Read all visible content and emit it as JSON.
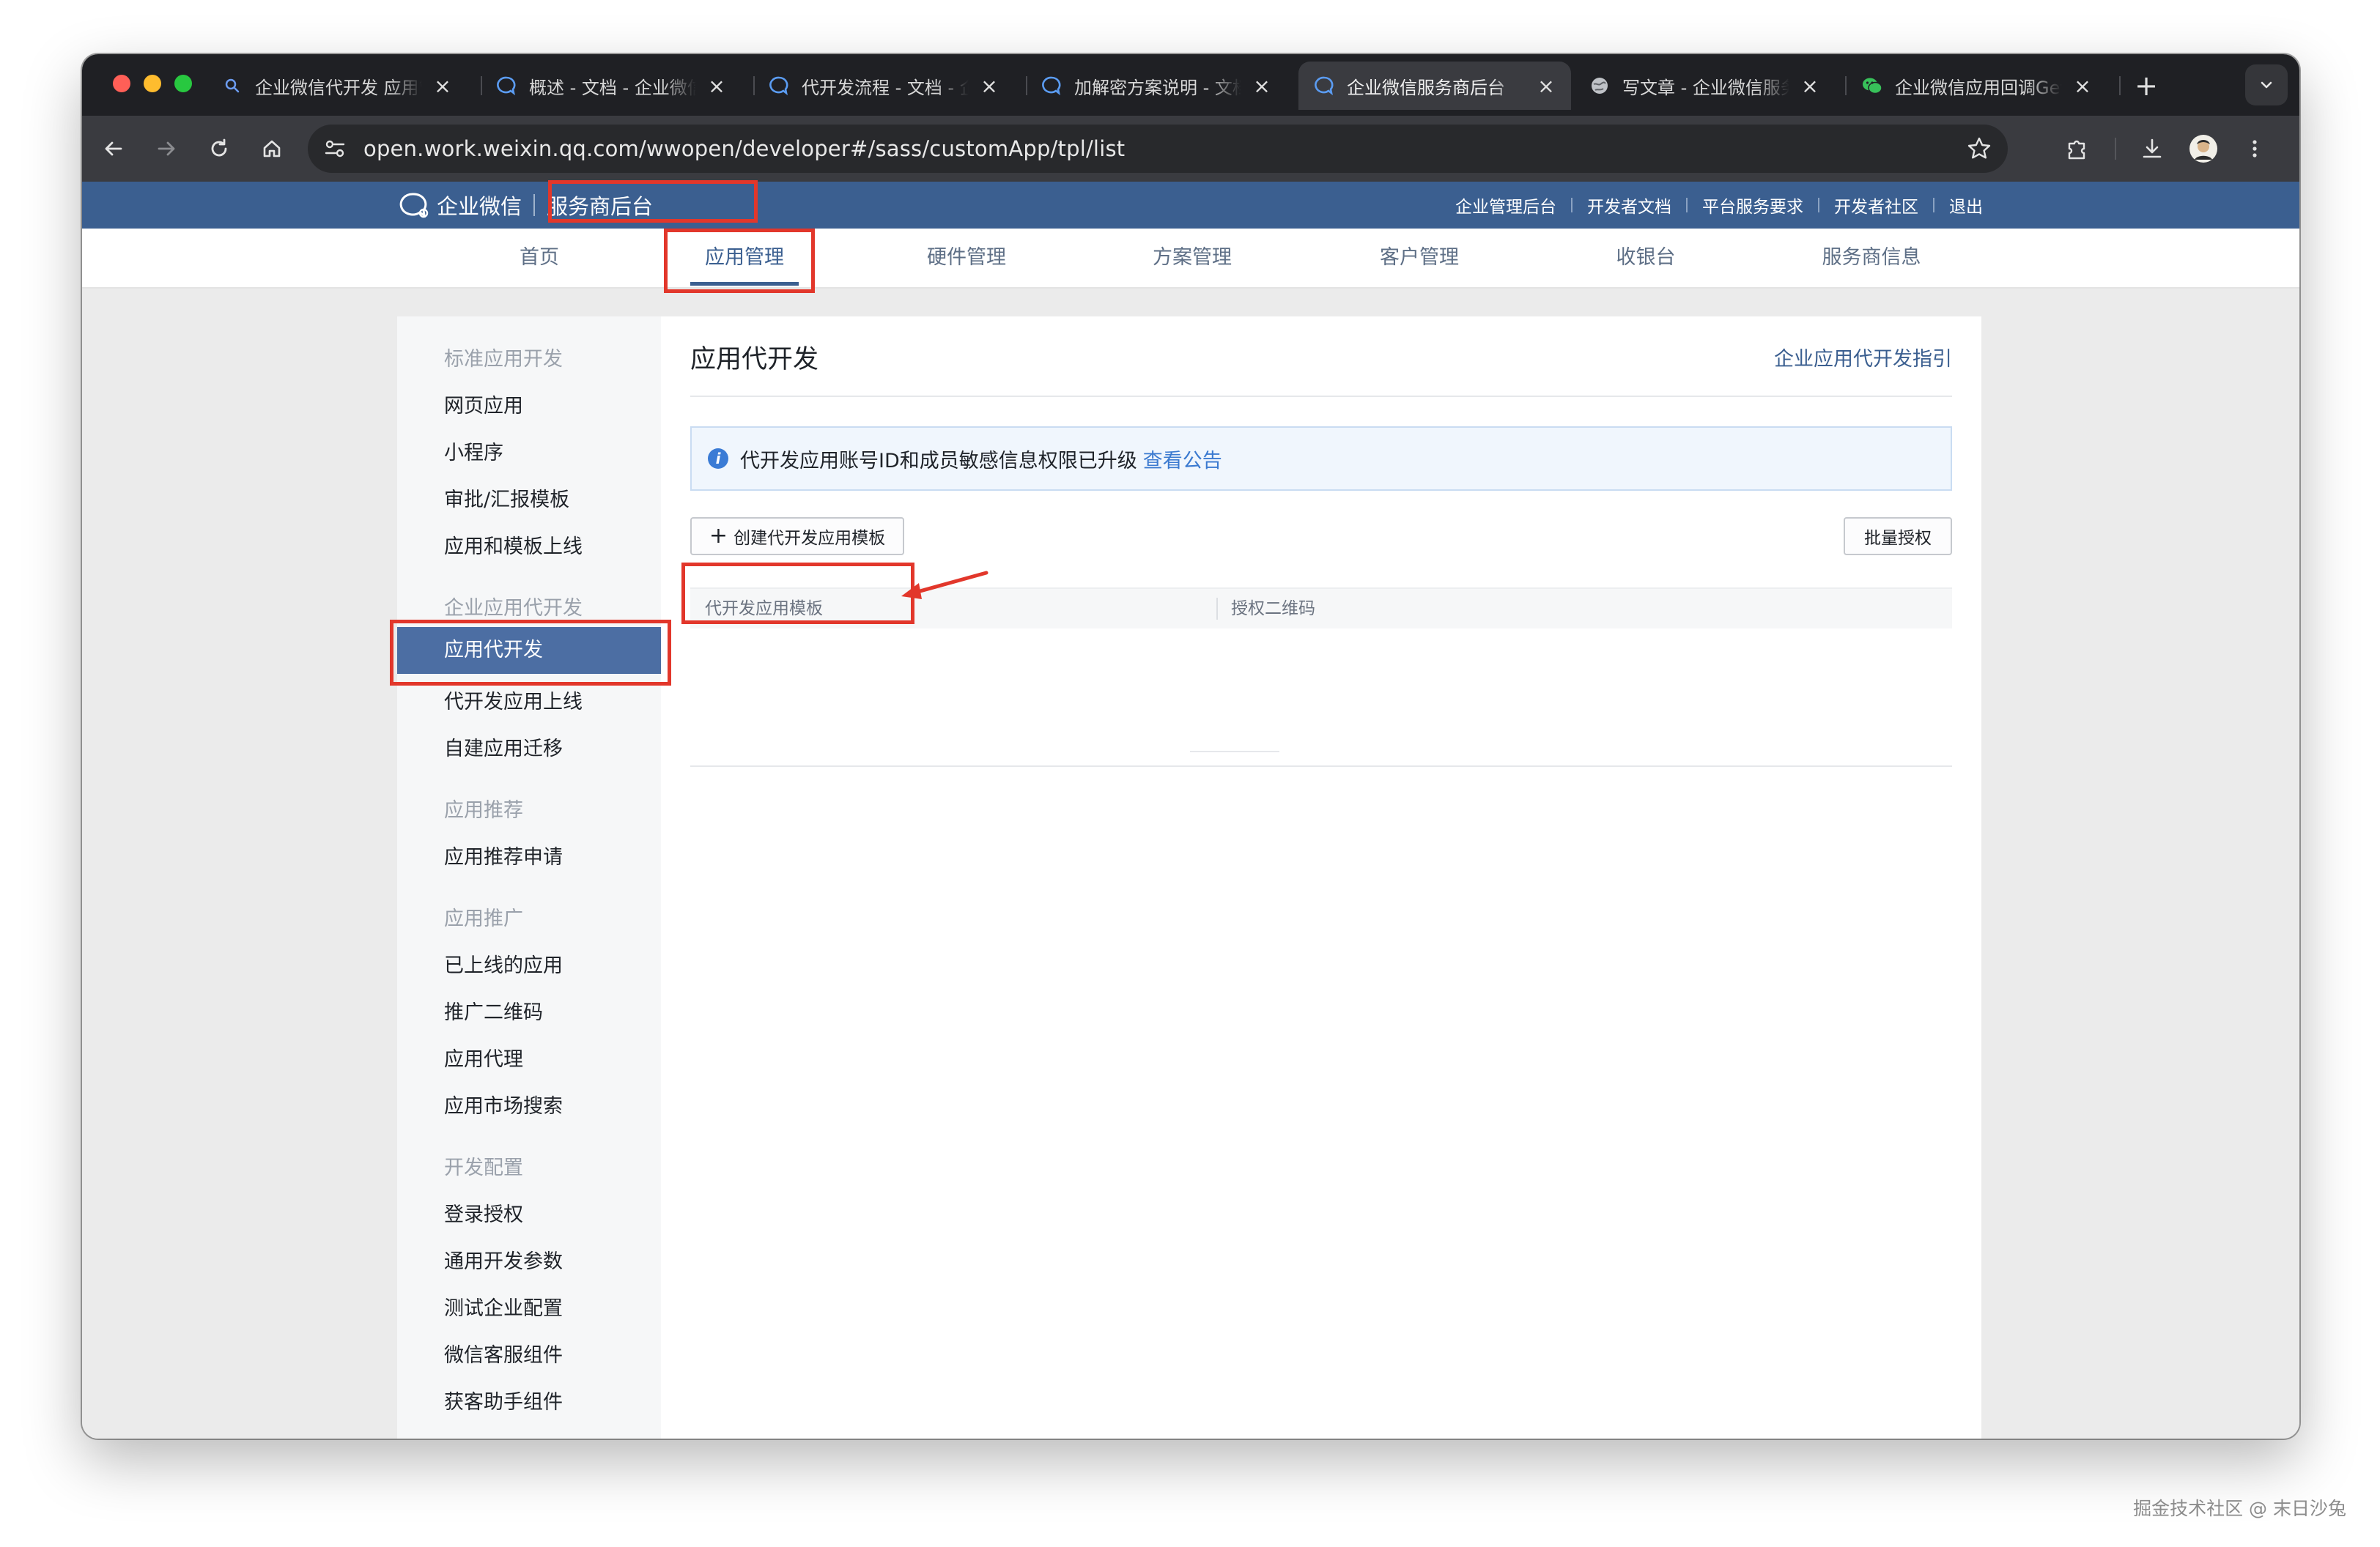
{
  "browser": {
    "tabs": [
      {
        "title": "企业微信代开发 应用管理",
        "icon": "search-icon"
      },
      {
        "title": "概述 - 文档 - 企业微信开发者中心",
        "icon": "wecom-icon"
      },
      {
        "title": "代开发流程 - 文档 - 企业微信",
        "icon": "wecom-icon"
      },
      {
        "title": "加解密方案说明 - 文档",
        "icon": "wecom-icon"
      },
      {
        "title": "企业微信服务商后台",
        "icon": "wecom-icon",
        "active": true
      },
      {
        "title": "写文章 - 企业微信服务商",
        "icon": "globe-icon"
      },
      {
        "title": "企业微信应用回调Get",
        "icon": "wechat-icon"
      }
    ],
    "new_tab": "+",
    "url": "open.work.weixin.qq.com/wwopen/developer#/sass/customApp/tpl/list"
  },
  "header": {
    "logo_text": "企业微信",
    "subtitle": "服务商后台",
    "links": [
      "企业管理后台",
      "开发者文档",
      "平台服务要求",
      "开发者社区",
      "退出"
    ]
  },
  "nav": {
    "items": [
      "首页",
      "应用管理",
      "硬件管理",
      "方案管理",
      "客户管理",
      "收银台",
      "服务商信息"
    ],
    "active_index": 1
  },
  "sidebar": {
    "groups": [
      {
        "title": "标准应用开发",
        "items": [
          "网页应用",
          "小程序",
          "审批/汇报模板",
          "应用和模板上线"
        ]
      },
      {
        "title": "企业应用代开发",
        "items": [
          "应用代开发",
          "代开发应用上线",
          "自建应用迁移"
        ]
      },
      {
        "title": "应用推荐",
        "items": [
          "应用推荐申请"
        ]
      },
      {
        "title": "应用推广",
        "items": [
          "已上线的应用",
          "推广二维码",
          "应用代理",
          "应用市场搜索"
        ]
      },
      {
        "title": "开发配置",
        "items": [
          "登录授权",
          "通用开发参数",
          "测试企业配置",
          "微信客服组件",
          "获客助手组件"
        ]
      }
    ],
    "active_item": "应用代开发"
  },
  "main": {
    "title": "应用代开发",
    "guide_link": "企业应用代开发指引",
    "notice_text": "代开发应用账号ID和成员敏感信息权限已升级",
    "notice_link": "查看公告",
    "create_button": "创建代开发应用模板",
    "batch_button": "批量授权",
    "table_headers": [
      "代开发应用模板",
      "授权二维码"
    ]
  },
  "watermark": "掘金技术社区 @ 末日沙兔",
  "colors": {
    "brand_blue": "#3b5f90",
    "active_sidebar": "#4c6ea3",
    "annotation_red": "#e2372b",
    "link_blue": "#3b7ad0"
  }
}
